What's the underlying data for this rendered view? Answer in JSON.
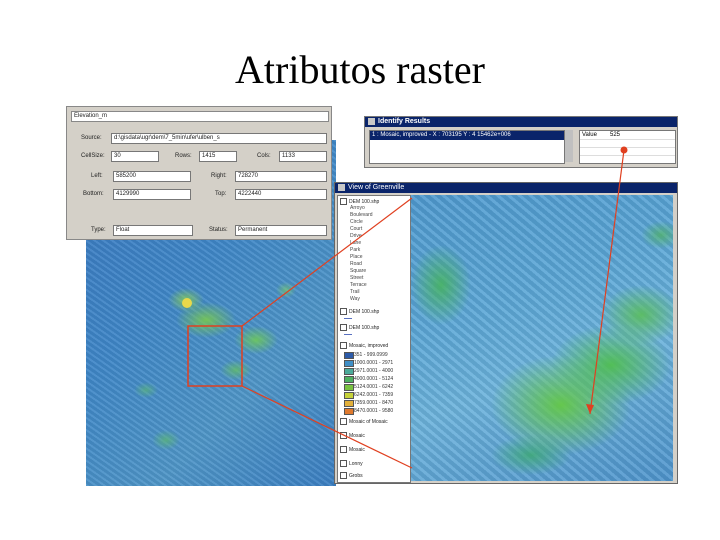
{
  "slide": {
    "title": "Atributos raster"
  },
  "properties": {
    "name": "Elevation_m",
    "source_label": "Source:",
    "source_value": "d:\\gisdata\\ugr\\dem\\7_5min\\ufer\\ulben_s",
    "cellsize_label": "CellSize:",
    "cellsize_value": "30",
    "rows_label": "Rows:",
    "rows_value": "1415",
    "cols_label": "Cols:",
    "cols_value": "1133",
    "left_label": "Left:",
    "left_value": "585200",
    "right_label": "Right:",
    "right_value": "728270",
    "bottom_label": "Bottom:",
    "bottom_value": "4129990",
    "top_label": "Top:",
    "top_value": "4222440",
    "type_label": "Type:",
    "type_value": "Float",
    "status_label": "Status:",
    "status_value": "Permanent"
  },
  "identify": {
    "title": "Identify Results",
    "result_row": "1 : Mosaic, improved - X : 703195  Y : 4 15462e+006",
    "value_label": "Value",
    "value": "525"
  },
  "view": {
    "title": "View of Greenville",
    "toc": [
      {
        "label": "DEM 100.shp"
      },
      {
        "label": "DEM 100.shp"
      },
      {
        "label": "DEM 100.shp"
      },
      {
        "label": "Mosaic, improved"
      },
      {
        "label": "Mosaic of Mosaic"
      },
      {
        "label": "Mosaic"
      },
      {
        "label": "Mosaic"
      },
      {
        "label": "Lonny"
      },
      {
        "label": "Grobs"
      }
    ],
    "legend_lines": [
      "Arroyo",
      "Boulevard",
      "Circle",
      "Court",
      "Drive",
      "Lane",
      "Park",
      "Place",
      "Road",
      "Square",
      "Street",
      "Terrace",
      "Trail",
      "Way"
    ],
    "elevation_classes": [
      "351 - 999.0999",
      "1000.0001 - 2971",
      "2971.0001 - 4000",
      "4000.0001 - 5124",
      "5124.0001 - 6242",
      "6242.0001 - 7359",
      "7359.0001 - 8470",
      "8470.0001 - 9580"
    ],
    "elevation_colors": [
      "#2c5aa8",
      "#3f8ec6",
      "#4caa9a",
      "#4fb060",
      "#79c240",
      "#c6d23a",
      "#e2b03a",
      "#e07a2e"
    ]
  },
  "colors": {
    "link_line": "#e04020",
    "titlebar": "#0a246a"
  }
}
